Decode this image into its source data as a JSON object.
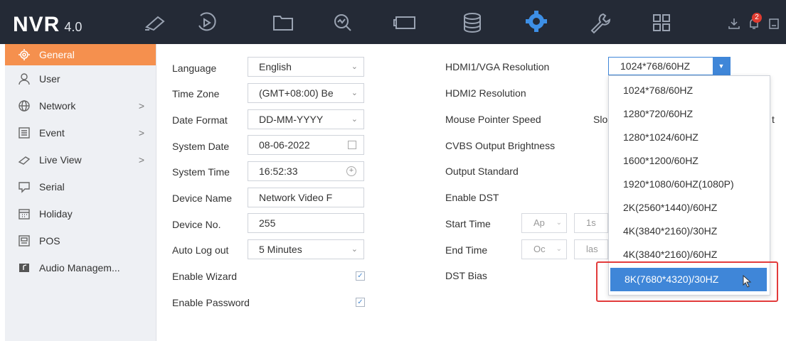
{
  "app": {
    "logo_text": "NVR",
    "logo_version": "4.0",
    "notification_count": "2"
  },
  "toolbar": {
    "icons": [
      "live-view-icon",
      "playback-icon",
      "file-icon",
      "smart-analysis-icon",
      "display-icon",
      "storage-icon",
      "configuration-icon",
      "maintenance-icon",
      "layout-icon"
    ],
    "active": "configuration-icon"
  },
  "sidebar": {
    "items": [
      {
        "label": "General",
        "icon": "gear-icon",
        "active": true
      },
      {
        "label": "User",
        "icon": "user-icon"
      },
      {
        "label": "Network",
        "icon": "globe-icon",
        "expandable": true
      },
      {
        "label": "Event",
        "icon": "event-icon",
        "expandable": true
      },
      {
        "label": "Live View",
        "icon": "camera-icon",
        "expandable": true
      },
      {
        "label": "Serial",
        "icon": "serial-icon"
      },
      {
        "label": "Holiday",
        "icon": "calendar-icon"
      },
      {
        "label": "POS",
        "icon": "pos-icon"
      },
      {
        "label": "Audio Managem...",
        "icon": "audio-icon"
      }
    ]
  },
  "left_form": {
    "language": {
      "label": "Language",
      "value": "English"
    },
    "time_zone": {
      "label": "Time Zone",
      "value": "(GMT+08:00) Be"
    },
    "date_format": {
      "label": "Date Format",
      "value": "DD-MM-YYYY"
    },
    "system_date": {
      "label": "System Date",
      "value": "08-06-2022"
    },
    "system_time": {
      "label": "System Time",
      "value": "16:52:33"
    },
    "device_name": {
      "label": "Device Name",
      "value": "Network Video F"
    },
    "device_no": {
      "label": "Device No.",
      "value": "255"
    },
    "auto_logout": {
      "label": "Auto Log out",
      "value": "5 Minutes"
    },
    "enable_wizard": {
      "label": "Enable Wizard",
      "checked": true
    },
    "enable_password": {
      "label": "Enable Password",
      "checked": true
    }
  },
  "right_form": {
    "hdmi1_vga": {
      "label": "HDMI1/VGA Resolution",
      "value": "1024*768/60HZ"
    },
    "hdmi2": {
      "label": "HDMI2 Resolution"
    },
    "mouse_speed": {
      "label": "Mouse Pointer Speed",
      "partial_left": "Slo",
      "partial_right": "t"
    },
    "cvbs": {
      "label": "CVBS Output Brightness"
    },
    "output_standard": {
      "label": "Output Standard"
    },
    "enable_dst": {
      "label": "Enable DST"
    },
    "start_time": {
      "label": "Start Time",
      "month": "Ap",
      "week": "1s"
    },
    "end_time": {
      "label": "End Time",
      "month": "Oc",
      "week": "las"
    },
    "dst_bias": {
      "label": "DST Bias"
    }
  },
  "resolution_dropdown": {
    "options": [
      "1024*768/60HZ",
      "1280*720/60HZ",
      "1280*1024/60HZ",
      "1600*1200/60HZ",
      "1920*1080/60HZ(1080P)",
      "2K(2560*1440)/60HZ",
      "4K(3840*2160)/30HZ",
      "4K(3840*2160)/60HZ",
      "8K(7680*4320)/30HZ"
    ],
    "highlighted_index": 8
  }
}
